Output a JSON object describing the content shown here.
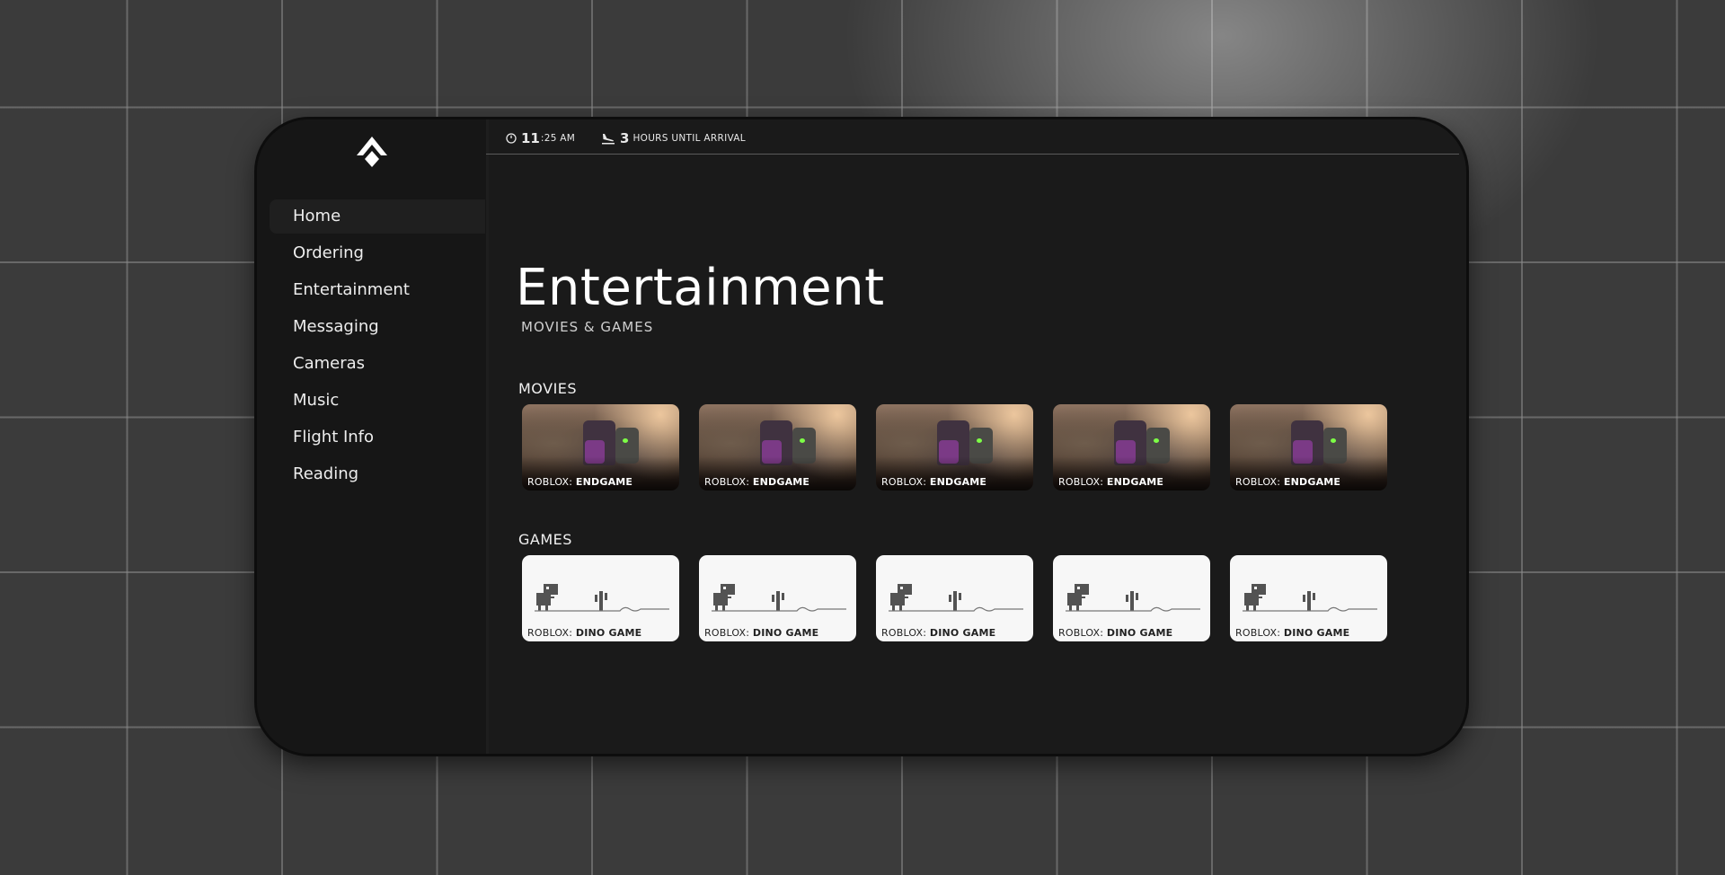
{
  "sidebar": {
    "items": [
      {
        "label": "Home",
        "active": true
      },
      {
        "label": "Ordering"
      },
      {
        "label": "Entertainment"
      },
      {
        "label": "Messaging"
      },
      {
        "label": "Cameras"
      },
      {
        "label": "Music"
      },
      {
        "label": "Flight Info"
      },
      {
        "label": "Reading"
      }
    ]
  },
  "status": {
    "time_hour": "11",
    "time_rest": ":25 AM",
    "arrival_hours": "3",
    "arrival_label": "HOURS UNTIL ARRIVAL"
  },
  "page": {
    "title": "Entertainment",
    "subtitle": "MOVIES & GAMES"
  },
  "movies": {
    "title": "MOVIES",
    "items": [
      {
        "prefix": "ROBLOX:",
        "name": "ENDGAME"
      },
      {
        "prefix": "ROBLOX:",
        "name": "ENDGAME"
      },
      {
        "prefix": "ROBLOX:",
        "name": "ENDGAME"
      },
      {
        "prefix": "ROBLOX:",
        "name": "ENDGAME"
      },
      {
        "prefix": "ROBLOX:",
        "name": "ENDGAME"
      }
    ]
  },
  "games": {
    "title": "GAMES",
    "items": [
      {
        "prefix": "ROBLOX:",
        "name": "DINO GAME"
      },
      {
        "prefix": "ROBLOX:",
        "name": "DINO GAME"
      },
      {
        "prefix": "ROBLOX:",
        "name": "DINO GAME"
      },
      {
        "prefix": "ROBLOX:",
        "name": "DINO GAME"
      },
      {
        "prefix": "ROBLOX:",
        "name": "DINO GAME"
      }
    ]
  },
  "icons": {
    "logo": "brand-logo-icon",
    "clock": "clock-icon",
    "arrival": "plane-landing-icon"
  },
  "colors": {
    "panel": "#1a1a1a",
    "sidebar": "#161616",
    "active_item": "#1f1f1f",
    "text": "#ffffff"
  }
}
